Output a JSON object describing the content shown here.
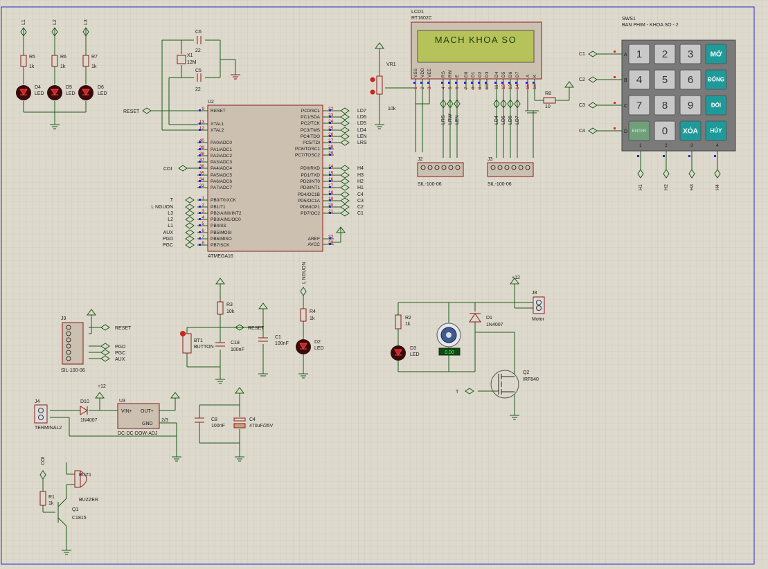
{
  "mcu": {
    "ref": "U2",
    "part": "ATMEGA16",
    "left_pins": [
      {
        "n": "9",
        "name": "RESET",
        "net": "RESET"
      },
      {
        "n": "13",
        "name": "XTAL1",
        "net": ""
      },
      {
        "n": "12",
        "name": "XTAL2",
        "net": ""
      },
      {
        "n": "40",
        "name": "PA0/ADC0",
        "net": ""
      },
      {
        "n": "39",
        "name": "PA1/ADC1",
        "net": ""
      },
      {
        "n": "38",
        "name": "PA2/ADC2",
        "net": ""
      },
      {
        "n": "37",
        "name": "PA3/ADC3",
        "net": ""
      },
      {
        "n": "36",
        "name": "PA4/ADC4",
        "net": "COI"
      },
      {
        "n": "35",
        "name": "PA5/ADC5",
        "net": ""
      },
      {
        "n": "34",
        "name": "PA6/ADC6",
        "net": ""
      },
      {
        "n": "33",
        "name": "PA7/ADC7",
        "net": ""
      },
      {
        "n": "1",
        "name": "PB0/T0/XCK",
        "net": "T"
      },
      {
        "n": "2",
        "name": "PB1/T1",
        "net": "L NGUON"
      },
      {
        "n": "3",
        "name": "PB2/AIN0/INT2",
        "net": "L3"
      },
      {
        "n": "4",
        "name": "PB3/AIN1/OC0",
        "net": "L2"
      },
      {
        "n": "5",
        "name": "PB4/SS",
        "net": "L1"
      },
      {
        "n": "6",
        "name": "PB5/MOSI",
        "net": "AUX"
      },
      {
        "n": "7",
        "name": "PB6/MISO",
        "net": "PGD"
      },
      {
        "n": "8",
        "name": "PB7/SCK",
        "net": "PGC"
      }
    ],
    "right_pins": [
      {
        "n": "22",
        "name": "PC0/SCL",
        "net": "LD7"
      },
      {
        "n": "23",
        "name": "PC1/SDA",
        "net": "LD6"
      },
      {
        "n": "24",
        "name": "PC2/TCK",
        "net": "LD5"
      },
      {
        "n": "25",
        "name": "PC3/TMS",
        "net": "LD4"
      },
      {
        "n": "26",
        "name": "PC4/TDO",
        "net": "LEN"
      },
      {
        "n": "27",
        "name": "PC5/TDI",
        "net": "LRS"
      },
      {
        "n": "28",
        "name": "PC6/TOSC1",
        "net": ""
      },
      {
        "n": "29",
        "name": "PC7/TOSC2",
        "net": ""
      },
      {
        "n": "14",
        "name": "PD0/RXD",
        "net": "H4"
      },
      {
        "n": "15",
        "name": "PD1/TXD",
        "net": "H3"
      },
      {
        "n": "16",
        "name": "PD2/INT0",
        "net": "H2"
      },
      {
        "n": "17",
        "name": "PD3/INT1",
        "net": "H1"
      },
      {
        "n": "18",
        "name": "PD4/OC1B",
        "net": "C4"
      },
      {
        "n": "19",
        "name": "PD5/OC1A",
        "net": "C3"
      },
      {
        "n": "20",
        "name": "PD6/ICP1",
        "net": "C2"
      },
      {
        "n": "21",
        "name": "PD7/OC2",
        "net": "C1"
      },
      {
        "n": "32",
        "name": "AREF",
        "net": ""
      },
      {
        "n": "30",
        "name": "AVCC",
        "net": ""
      }
    ]
  },
  "lcd": {
    "ref": "LCD1",
    "part": "RT1602C",
    "text": "MACH KHOA SO",
    "pins": [
      {
        "n": "1",
        "name": "VSS"
      },
      {
        "n": "2",
        "name": "VDD"
      },
      {
        "n": "3",
        "name": "VEE"
      },
      {
        "n": "4",
        "name": "RS"
      },
      {
        "n": "5",
        "name": "RW"
      },
      {
        "n": "6",
        "name": "E"
      },
      {
        "n": "7",
        "name": "D0"
      },
      {
        "n": "8",
        "name": "D1"
      },
      {
        "n": "9",
        "name": "D2"
      },
      {
        "n": "10",
        "name": "D3"
      },
      {
        "n": "11",
        "name": "D4"
      },
      {
        "n": "12",
        "name": "D5"
      },
      {
        "n": "13",
        "name": "D6"
      },
      {
        "n": "14",
        "name": "D7"
      },
      {
        "n": "15",
        "name": "A"
      },
      {
        "n": "16",
        "name": "K"
      }
    ]
  },
  "keypad": {
    "ref": "SWS1",
    "part": "BAN PHIM - KHOA SO - 2",
    "rows": [
      "A",
      "B",
      "C",
      "D"
    ],
    "row_nets": [
      "C1",
      "C2",
      "C3",
      "C4"
    ],
    "col_nums": [
      "1",
      "2",
      "3",
      "4"
    ],
    "col_nets": [
      "H1",
      "H2",
      "H3",
      "H4"
    ],
    "keys": [
      "1",
      "2",
      "3",
      "MỞ",
      "4",
      "5",
      "6",
      "ĐÓNG",
      "7",
      "8",
      "9",
      "ĐỔI",
      "ENTER",
      "0",
      "XÓA",
      "HỦY"
    ]
  },
  "labels": {
    "l1": "L1",
    "l2": "L2",
    "l3": "L3",
    "r5": "R5",
    "r6": "R6",
    "r7": "R7",
    "k1a": "1k",
    "k1b": "1k",
    "k1c": "1k",
    "d4": "D4",
    "d5": "D5",
    "d6": "D6",
    "led_a": "LED",
    "led_b": "LED",
    "led_c": "LED",
    "c6": "C6",
    "c6v": "22",
    "x1": "X1",
    "x1v": "12M",
    "c5": "C5",
    "c5v": "22",
    "reset_net": "RESET",
    "coi_net": "COI",
    "vr1": "VR1",
    "vr1v": "10k",
    "r8": "R8",
    "r8v": "10",
    "j2": "J2",
    "j2p": "SIL-100-06",
    "j3": "J3",
    "j3p": "SIL-100-06",
    "lrs": "LRS",
    "lrw": "LRW",
    "len": "LEN",
    "ld4": "LD4",
    "ld5": "LD5",
    "ld6": "LD6",
    "ld7": "LD7",
    "j9": "J9",
    "j9p": "SIL-100-06",
    "j9_reset": "RESET",
    "pgd": "PGD",
    "pgc": "PGC",
    "aux": "AUX",
    "r3": "R3",
    "r3v": "10k",
    "bt1": "BT1",
    "bt1p": "BUTTON",
    "c18": "C18",
    "c18v": "100nF",
    "reset2": "RESET",
    "c1": "C1",
    "c1v": "100nF",
    "lnguon": "L NGUON",
    "r4": "R4",
    "r4v": "1k",
    "d2": "D2",
    "d2l": "LED",
    "plus12a": "+12",
    "r2": "R2",
    "r2v": "1k",
    "d3": "D3",
    "d3l": "LED",
    "d1": "D1",
    "d1p": "1N4007",
    "j8": "J8",
    "motor": "Motor",
    "q2": "Q2",
    "q2p": "IRF840",
    "t_net": "T",
    "meter": "0.00",
    "plus12b": "+12",
    "j4": "J4",
    "j4p": "TERMINAL2",
    "d10": "D10",
    "d10p": "1N4007",
    "u3": "U3",
    "u3p": "DC-DC-DOW-ADJ",
    "vin": "VIN+",
    "vout": "OUT+",
    "gnd": "GND",
    "u3pin23": "2/3",
    "c8": "C8",
    "c8v": "100nF",
    "c4": "C4",
    "c4v": "470uF/25V",
    "coi2": "COI",
    "buz": "BUZ1",
    "buzp": "BUZZER",
    "r1": "R1",
    "r1v": "1k",
    "q1": "Q1",
    "q1p": "C1815"
  },
  "colors": {
    "background": "#ddd9cc",
    "grid": "#c9c4b6",
    "wire": "#1a5a1a",
    "component": "#8b1b1b",
    "chip_body": "#ccc0b0",
    "lcd_screen": "#b6c25a",
    "lcd_text": "#1d3d0f",
    "keypad_body": "#7a7a7a",
    "key_grey": "#c8c8c8",
    "key_teal": "#1f9a9a",
    "key_enter": "#6fa07a",
    "pin_blue": "#2222ee",
    "pin_red": "#ee2222"
  }
}
